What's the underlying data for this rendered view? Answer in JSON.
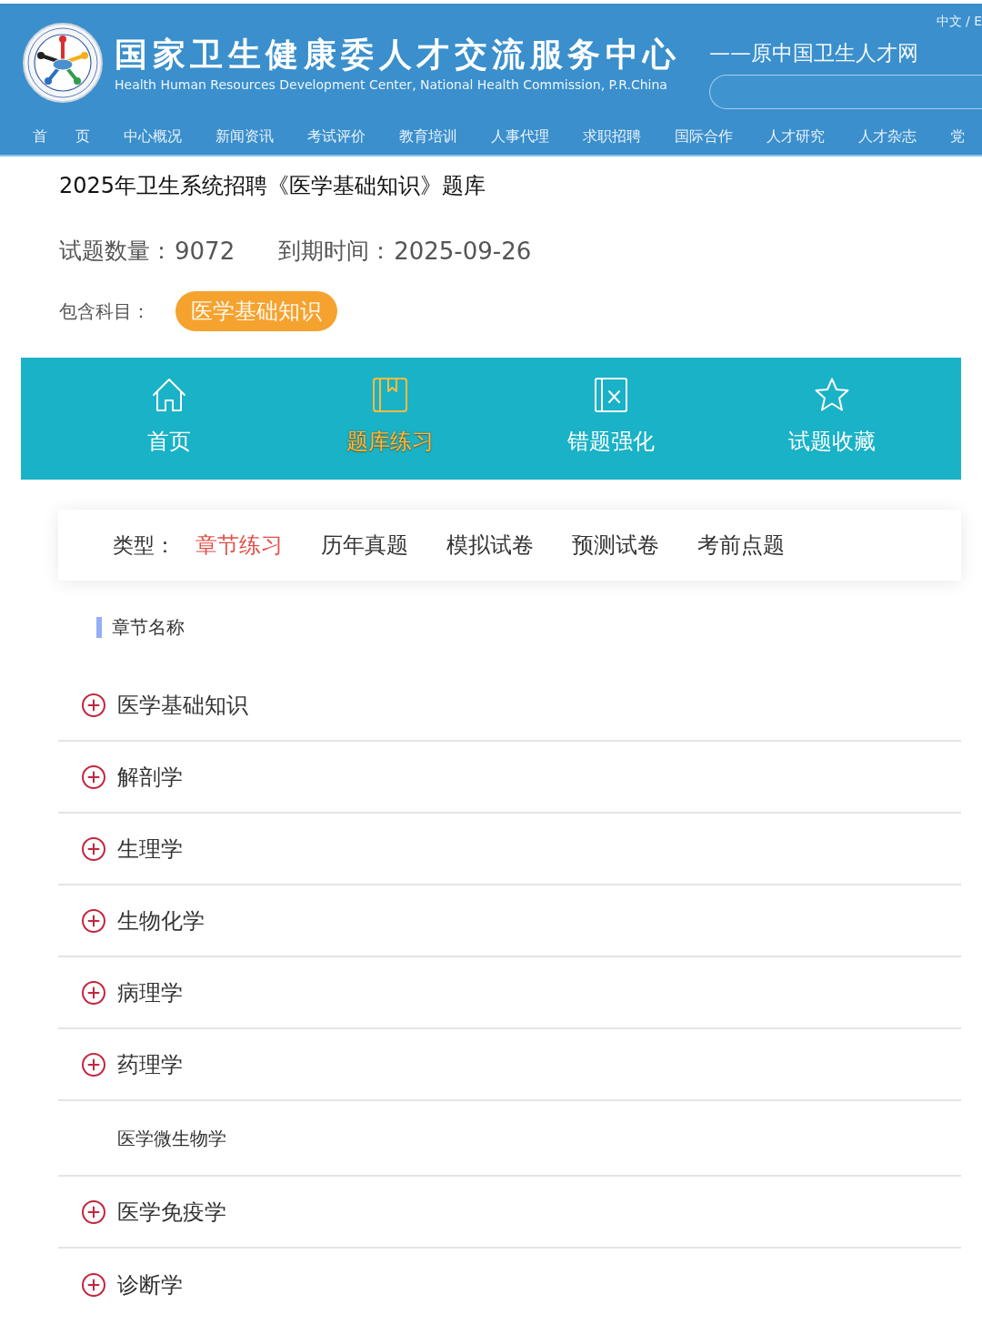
{
  "header": {
    "title": "国家卫生健康委人才交流服务中心",
    "subtitle": "Health Human Resources Development Center, National Health Commission, P.R.China",
    "former_name": "——原中国卫生人才网",
    "language_switch": "中文 / E"
  },
  "nav": [
    "首 页",
    "中心概况",
    "新闻资讯",
    "考试评价",
    "教育培训",
    "人事代理",
    "求职招聘",
    "国际合作",
    "人才研究",
    "人才杂志",
    "党"
  ],
  "bank": {
    "title": "2025年卫生系统招聘《医学基础知识》题库",
    "stats": [
      {
        "label": "试题数量：",
        "value": "9072"
      },
      {
        "label": "到期时间：",
        "value": "2025-09-26"
      }
    ],
    "subjects_label": "包含科目：",
    "subjects": [
      "医学基础知识"
    ]
  },
  "tabs": [
    {
      "label": "首页",
      "kind": "home",
      "selected": false
    },
    {
      "label": "题库练习",
      "kind": "bank",
      "selected": true
    },
    {
      "label": "错题强化",
      "kind": "mistakes",
      "selected": false
    },
    {
      "label": "试题收藏",
      "kind": "favorites",
      "selected": false
    }
  ],
  "filter": {
    "label": "类型：",
    "options": [
      {
        "label": "章节练习",
        "selected": true
      },
      {
        "label": "历年真题",
        "selected": false
      },
      {
        "label": "模拟试卷",
        "selected": false
      },
      {
        "label": "预测试卷",
        "selected": false
      },
      {
        "label": "考前点题",
        "selected": false
      }
    ]
  },
  "chapters": {
    "heading": "章节名称",
    "items": [
      {
        "label": "医学基础知识",
        "kind": "group"
      },
      {
        "label": "解剖学",
        "kind": "group"
      },
      {
        "label": "生理学",
        "kind": "group"
      },
      {
        "label": "生物化学",
        "kind": "group"
      },
      {
        "label": "病理学",
        "kind": "group"
      },
      {
        "label": "药理学",
        "kind": "group"
      },
      {
        "label": "医学微生物学",
        "kind": "leaf"
      },
      {
        "label": "医学免疫学",
        "kind": "group"
      },
      {
        "label": "诊断学",
        "kind": "group"
      }
    ]
  }
}
